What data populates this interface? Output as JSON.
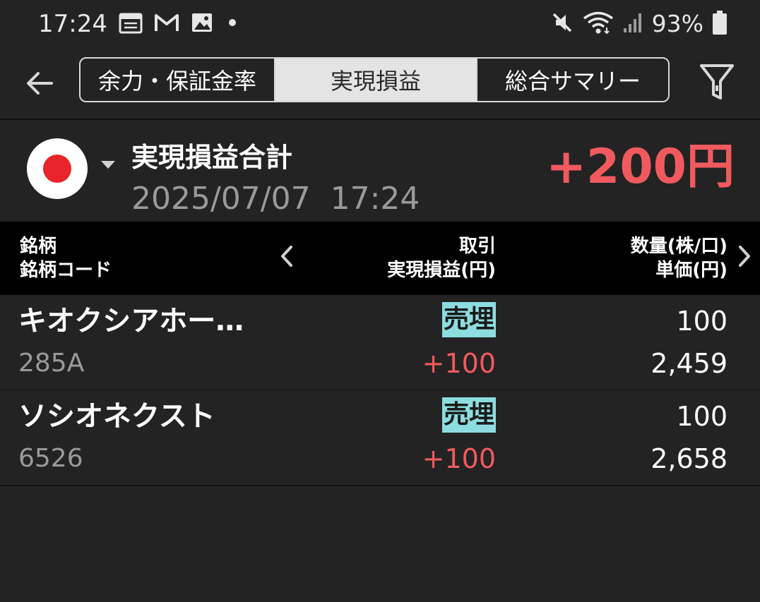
{
  "status_bar": {
    "time": "17:24",
    "battery_percent": "93%",
    "icons_left": [
      "calendar-icon",
      "gmail-icon",
      "gallery-icon",
      "notification-dot-icon"
    ],
    "icons_right": [
      "mute-icon",
      "wifi-icon",
      "signal-icon",
      "battery-icon"
    ]
  },
  "appbar": {
    "tabs": [
      {
        "label": "余力・保証金率",
        "selected": false
      },
      {
        "label": "実現損益",
        "selected": true
      },
      {
        "label": "総合サマリー",
        "selected": false
      }
    ]
  },
  "summary": {
    "title": "実現損益合計",
    "datetime": "2025/07/07  17:24",
    "total": "+200円"
  },
  "table": {
    "headers": {
      "col1_line1": "銘柄",
      "col1_line2": "銘柄コード",
      "col2_line1": "取引",
      "col2_line2": "実現損益(円)",
      "col3_line1": "数量(株/口)",
      "col3_line2": "単価(円)"
    },
    "rows": [
      {
        "name": "キオクシアホー…",
        "code": "285A",
        "trade": "売埋",
        "pl": "+100",
        "qty": "100",
        "price": "2,459"
      },
      {
        "name": "ソシオネクスト",
        "code": "6526",
        "trade": "売埋",
        "pl": "+100",
        "qty": "100",
        "price": "2,658"
      }
    ]
  },
  "colors": {
    "background": "#232323",
    "header_background": "#000000",
    "profit_red": "#f05a5f",
    "badge_cyan": "#8ddde0",
    "muted_text": "#9a9a9a"
  }
}
